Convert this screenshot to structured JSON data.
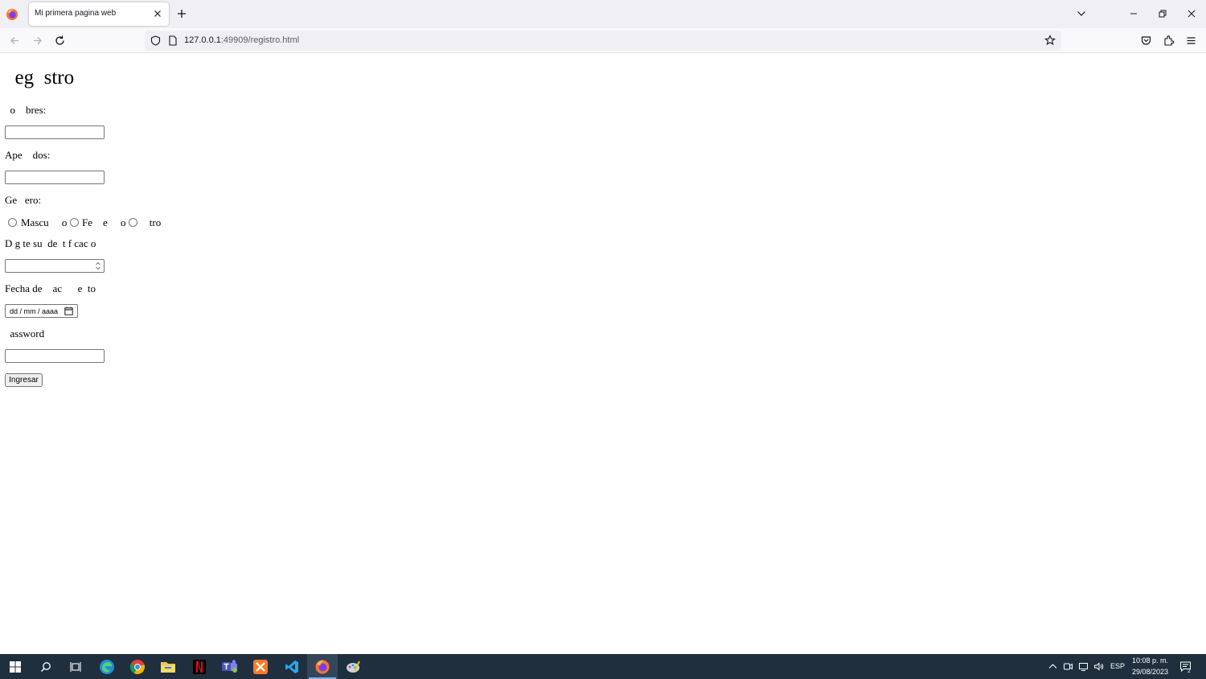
{
  "browser": {
    "tab_title": "Mi primera pagina web",
    "url_host": "127.0.0.1",
    "url_rest": ":49909/registro.html"
  },
  "page": {
    "heading": "  eg  stro",
    "label_nombres": "  o    bres:",
    "label_apellidos": "Ape    dos:",
    "label_genero": "Ge   ero:",
    "radio_masculino": "Mascu     o",
    "radio_femenino": "Fe    e     o",
    "radio_otro": "   tro",
    "label_identificacion": "D g te su  de  t f cac o",
    "label_fecha": "Fecha de    ac      e  to",
    "date_placeholder": "dd / mm / aaaa",
    "label_password": "  assword",
    "submit_label": "Ingresar"
  },
  "taskbar": {
    "icons": [
      "windows-start-icon",
      "search-icon",
      "task-view-icon",
      "edge-icon",
      "chrome-icon",
      "file-explorer-icon",
      "netflix-icon",
      "teams-icon",
      "xampp-icon",
      "vscode-icon",
      "firefox-icon",
      "paint-icon"
    ],
    "language": "ESP",
    "time": "10:08 p. m.",
    "date": "29/08/2023",
    "notification_count": "2"
  },
  "colors": {
    "taskbar_bg": "#1f2f3e",
    "chrome_bg": "#f0f0f4",
    "active_indicator": "#7fb2e5"
  }
}
